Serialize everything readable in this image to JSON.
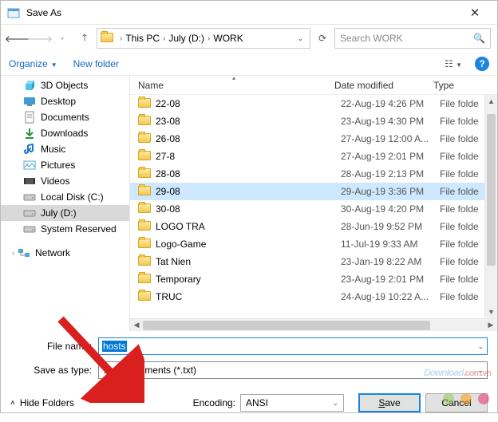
{
  "window": {
    "title": "Save As"
  },
  "nav": {
    "crumbs": [
      "This PC",
      "July (D:)",
      "WORK"
    ],
    "search_placeholder": "Search WORK"
  },
  "toolbar": {
    "organize": "Organize",
    "new_folder": "New folder",
    "help": "?"
  },
  "sidebar": {
    "items": [
      {
        "icon": "3d",
        "label": "3D Objects",
        "active": false
      },
      {
        "icon": "desktop",
        "label": "Desktop",
        "active": false
      },
      {
        "icon": "docs",
        "label": "Documents",
        "active": false
      },
      {
        "icon": "down",
        "label": "Downloads",
        "active": false
      },
      {
        "icon": "music",
        "label": "Music",
        "active": false
      },
      {
        "icon": "pics",
        "label": "Pictures",
        "active": false
      },
      {
        "icon": "video",
        "label": "Videos",
        "active": false
      },
      {
        "icon": "disk",
        "label": "Local Disk (C:)",
        "active": false
      },
      {
        "icon": "disk",
        "label": "July (D:)",
        "active": true
      },
      {
        "icon": "disk",
        "label": "System Reserved",
        "active": false
      }
    ],
    "network": "Network"
  },
  "columns": {
    "name": "Name",
    "date": "Date modified",
    "type": "Type"
  },
  "files": [
    {
      "name": "22-08",
      "date": "22-Aug-19 4:26 PM",
      "type": "File folde",
      "sel": false
    },
    {
      "name": "23-08",
      "date": "23-Aug-19 4:30 PM",
      "type": "File folde",
      "sel": false
    },
    {
      "name": "26-08",
      "date": "27-Aug-19 12:00 A...",
      "type": "File folde",
      "sel": false
    },
    {
      "name": "27-8",
      "date": "27-Aug-19 2:01 PM",
      "type": "File folde",
      "sel": false
    },
    {
      "name": "28-08",
      "date": "28-Aug-19 2:13 PM",
      "type": "File folde",
      "sel": false
    },
    {
      "name": "29-08",
      "date": "29-Aug-19 3:36 PM",
      "type": "File folde",
      "sel": true
    },
    {
      "name": "30-08",
      "date": "30-Aug-19 4:20 PM",
      "type": "File folde",
      "sel": false
    },
    {
      "name": "LOGO TRA",
      "date": "28-Jun-19 9:52 PM",
      "type": "File folde",
      "sel": false
    },
    {
      "name": "Logo-Game",
      "date": "11-Jul-19 9:33 AM",
      "type": "File folde",
      "sel": false
    },
    {
      "name": "Tat Nien",
      "date": "23-Jan-19 8:22 AM",
      "type": "File folde",
      "sel": false
    },
    {
      "name": "Temporary",
      "date": "23-Aug-19 2:01 PM",
      "type": "File folde",
      "sel": false
    },
    {
      "name": "TRUC",
      "date": "24-Aug-19 10:22 A...",
      "type": "File folde",
      "sel": false
    }
  ],
  "form": {
    "filename_label": "File name:",
    "filename_value": "hosts",
    "saveastype_label": "Save as type:",
    "saveastype_value": "Text Documents (*.txt)"
  },
  "bottom": {
    "hide_folders": "Hide Folders",
    "encoding_label": "Encoding:",
    "encoding_value": "ANSI",
    "save": "Save",
    "cancel": "Cancel"
  },
  "watermark": {
    "brand": "Download",
    "suffix": ".com.vn"
  }
}
